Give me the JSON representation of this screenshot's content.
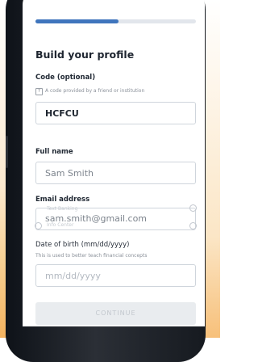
{
  "progress": {
    "fraction": 0.52
  },
  "form": {
    "title": "Build your profile",
    "code": {
      "label": "Code (optional)",
      "hint_icon": "?",
      "hint": "A code provided by a friend or institution",
      "value": "HCFCU"
    },
    "full_name": {
      "label": "Full name",
      "value": "Sam Smith"
    },
    "email": {
      "label": "Email address",
      "value": "sam.smith@gmail.com",
      "overlay_items": [
        "Text Banking",
        "Info Center"
      ]
    },
    "dob": {
      "label": "Date of birth (mm/dd/yyyy)",
      "hint": "This is used to better teach financial concepts",
      "placeholder": "mm/dd/yyyy"
    },
    "continue_label": "CONTINUE"
  },
  "colors": {
    "accent": "#3f75bd",
    "glow": "#f3b25f"
  }
}
